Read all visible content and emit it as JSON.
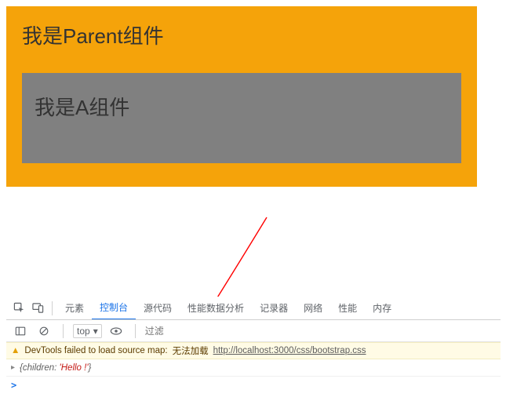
{
  "parent": {
    "title": "我是Parent组件"
  },
  "child": {
    "title": "我是A组件"
  },
  "devtools": {
    "tabs": {
      "elements": "元素",
      "console": "控制台",
      "sources": "源代码",
      "perf": "性能数据分析",
      "recorder": "记录器",
      "network": "网络",
      "perf2": "性能",
      "memory": "内存"
    },
    "toolbar": {
      "frame": "top",
      "filter_placeholder": "过滤"
    },
    "warning": {
      "prefix": "DevTools failed to load source map:",
      "cn": "无法加载",
      "link": "http://localhost:3000/css/bootstrap.css"
    },
    "log": {
      "key": "children",
      "value": "'Hello !'"
    },
    "caret": "▸",
    "dropdown_caret": "▾",
    "brace_open": "{",
    "brace_close": "}",
    "colon": ": ",
    "prompt": ">",
    "warn_glyph": "▲"
  }
}
